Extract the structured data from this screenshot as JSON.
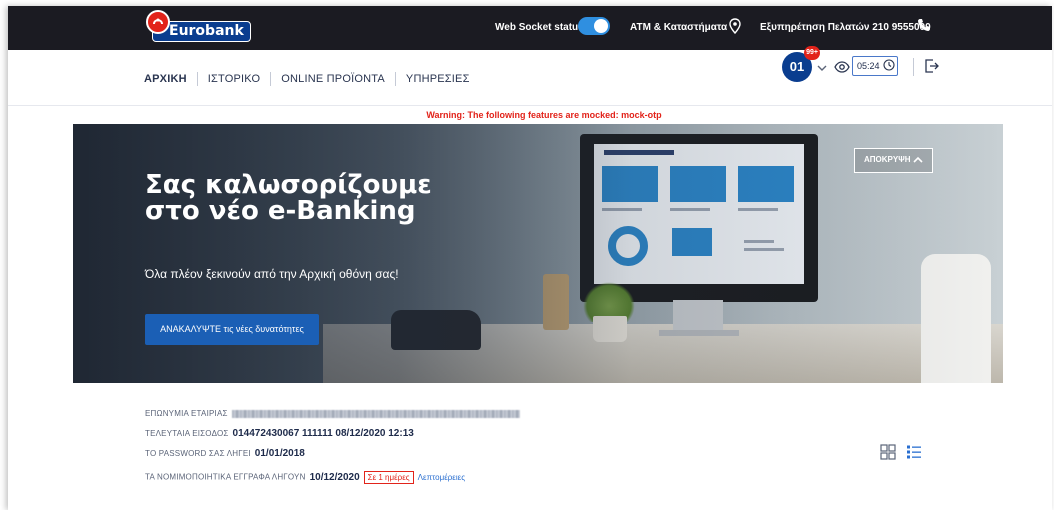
{
  "topbar": {
    "logo_text": "Eurobank",
    "ws_label": "Web Socket status",
    "atm_label": "ATM & Καταστήματα",
    "support_label": "Εξυπηρέτηση Πελατών 210 9555000"
  },
  "nav": {
    "items": [
      "ΑΡΧΙΚΗ",
      "ΙΣΤΟΡΙΚΟ",
      "ONLINE ΠΡΟΪΟΝΤΑ",
      "ΥΠΗΡΕΣΙΕΣ"
    ],
    "avatar_text": "01",
    "notif_count": "99+",
    "timer": "05:24"
  },
  "warning": "Warning: The following features are mocked: mock-otp",
  "hero": {
    "title": "Σας καλωσορίζουμε στο νέο e-Banking",
    "subtitle": "Όλα πλέον ξεκινούν από την Αρχική οθόνη σας!",
    "cta_label": "ΑΝΑΚΑΛΥΨΤΕ τις νέες δυνατότητες",
    "hide_label": "ΑΠΟΚΡΥΨΗ"
  },
  "info": {
    "company_label": "ΕΠΩΝΥΜΙΑ ΕΤΑΙΡΙΑΣ",
    "last_login_label": "ΤΕΛΕΥΤΑΙΑ ΕΙΣΟΔΟΣ",
    "last_login_value": "014472430067 111111 08/12/2020 12:13",
    "password_label": "ΤΟ PASSWORD ΣΑΣ ΛΗΓΕΙ",
    "password_value": "01/01/2018",
    "docs_label": "ΤΑ ΝΟΜΙΜΟΠΟΙΗΤΙΚΑ ΕΓΓΡΑΦΑ ΛΗΓΟΥΝ",
    "docs_value": "10/12/2020",
    "days_badge": "Σε 1 ημέρες",
    "details_link": "Λεπτομέρειες"
  },
  "colors": {
    "brand_blue": "#0a3d8f",
    "brand_red": "#e2231a",
    "accent_blue": "#1b5fb5",
    "topbar_bg": "#1b1b22"
  }
}
